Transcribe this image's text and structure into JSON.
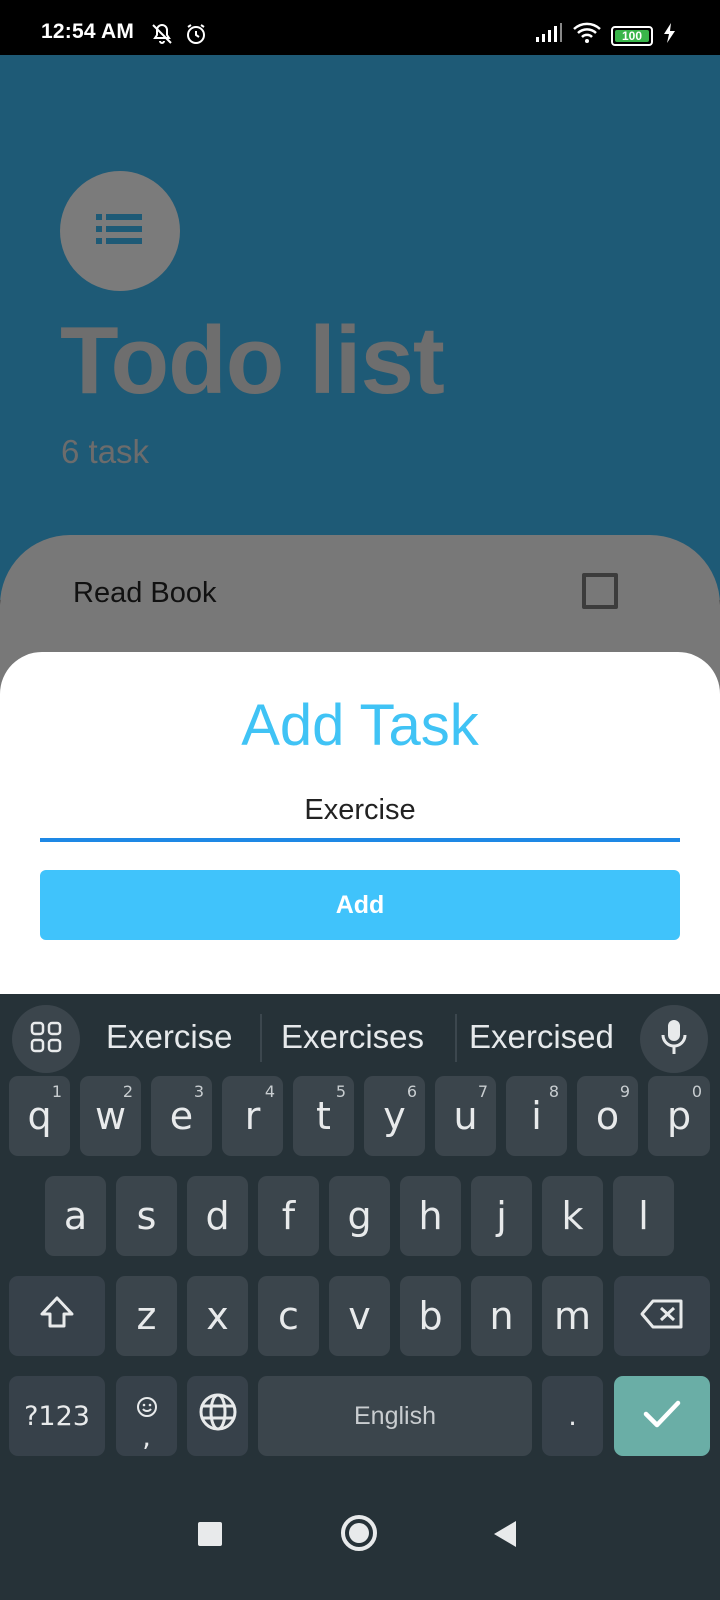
{
  "status_bar": {
    "time": "12:54 AM",
    "battery": "100",
    "icons": [
      "bell-off-icon",
      "alarm-icon",
      "signal-icon",
      "wifi-icon",
      "battery-icon",
      "charging-icon"
    ]
  },
  "app": {
    "title": "Todo list",
    "task_count": "6 task",
    "header_color": "#1e5a76",
    "icon": "list-icon"
  },
  "list": {
    "items": [
      {
        "label": "Read Book",
        "checked": false
      }
    ]
  },
  "dialog": {
    "title": "Add Task",
    "input_value": "Exercise",
    "add_button": "Add",
    "accent": "#40c3fb"
  },
  "keyboard": {
    "suggestions": [
      "Exercise",
      "Exercises",
      "Exercised"
    ],
    "row1": [
      {
        "key": "q",
        "hint": "1"
      },
      {
        "key": "w",
        "hint": "2"
      },
      {
        "key": "e",
        "hint": "3"
      },
      {
        "key": "r",
        "hint": "4"
      },
      {
        "key": "t",
        "hint": "5"
      },
      {
        "key": "y",
        "hint": "6"
      },
      {
        "key": "u",
        "hint": "7"
      },
      {
        "key": "i",
        "hint": "8"
      },
      {
        "key": "o",
        "hint": "9"
      },
      {
        "key": "p",
        "hint": "0"
      }
    ],
    "row2": [
      "a",
      "s",
      "d",
      "f",
      "g",
      "h",
      "j",
      "k",
      "l"
    ],
    "row3": [
      "z",
      "x",
      "c",
      "v",
      "b",
      "n",
      "m"
    ],
    "symbols_key": "?123",
    "comma_key": ",",
    "space_label": "English",
    "period_key": "."
  }
}
